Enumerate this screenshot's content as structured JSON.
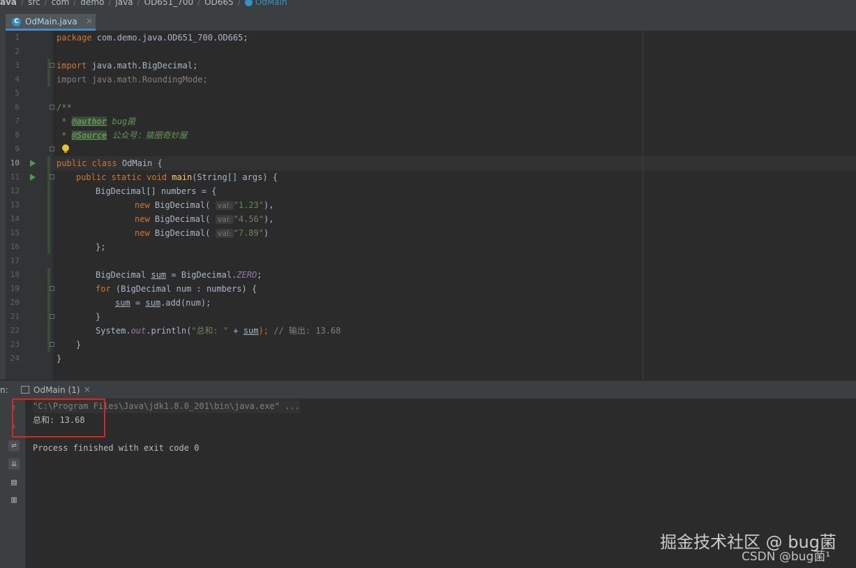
{
  "breadcrumb": [
    "ava",
    "src",
    "com",
    "demo",
    "java",
    "OD651_700",
    "OD665",
    "OdMain"
  ],
  "tab": {
    "icon": "class-icon",
    "label": "OdMain.java",
    "close": "×"
  },
  "gutter": {
    "lines": [
      "1",
      "2",
      "3",
      "4",
      "5",
      "6",
      "7",
      "8",
      "9",
      "10",
      "11",
      "12",
      "13",
      "14",
      "15",
      "16",
      "17",
      "18",
      "19",
      "20",
      "21",
      "22",
      "23",
      "24"
    ]
  },
  "code": {
    "l1": {
      "kw": "package",
      "rest": " com.demo.java.OD651_700.OD665;"
    },
    "l3": {
      "kw": "import",
      "rest": " java.math.BigDecimal;"
    },
    "l4": {
      "kw": "import",
      "rest": " java.math.RoundingMode;"
    },
    "l6": "/**",
    "l7": {
      "pre": " * ",
      "tag": "@author",
      "text": " bug菌"
    },
    "l8": {
      "pre": " * ",
      "tag": "@Source",
      "text": " 公众号：猿圈奇妙屋"
    },
    "l9": " */",
    "l10": {
      "kw": "public class",
      "rest": " OdMain {"
    },
    "l11": {
      "kw": "public static void",
      "fn": "main",
      "rest": "(String[] args) {"
    },
    "l12": "BigDecimal[] numbers = {",
    "l13": {
      "kw": "new",
      "cls": " BigDecimal(",
      "hint": "val:",
      "str": "\"1.23\"",
      "end": "),"
    },
    "l14": {
      "kw": "new",
      "cls": " BigDecimal(",
      "hint": "val:",
      "str": "\"4.56\"",
      "end": "),"
    },
    "l15": {
      "kw": "new",
      "cls": " BigDecimal(",
      "hint": "val:",
      "str": "\"7.89\"",
      "end": ")"
    },
    "l16": "};",
    "l18": {
      "type": "BigDecimal ",
      "var": "sum",
      "mid": " = BigDecimal.",
      "stat": "ZERO",
      "end": ";"
    },
    "l19": {
      "kw": "for",
      "rest": " (BigDecimal num : numbers) {"
    },
    "l20": {
      "var": "sum",
      "mid": " = ",
      "var2": "sum",
      "rest": ".add(num);"
    },
    "l21": "}",
    "l22": {
      "pre": "System.",
      "stat": "out",
      "mid": ".println(",
      "str": "\"总和: \"",
      "plus": " + ",
      "var": "sum",
      "end": ");",
      "comment": " // 输出: 13.68"
    },
    "l23": "}",
    "l24": "}"
  },
  "run_panel": {
    "prefix": "n:",
    "tab_label": "OdMain (1)",
    "tab_close": "×",
    "icons": [
      "up-arrow-icon",
      "down-arrow-icon",
      "soft-wrap-icon",
      "scroll-to-end-icon",
      "print-icon",
      "trash-icon"
    ],
    "console": {
      "command": "\"C:\\Program Files\\Java\\jdk1.8.0_201\\bin\\java.exe\" ...",
      "output": "总和: 13.68",
      "finished": "Process finished with exit code 0"
    }
  },
  "watermark": {
    "line1": "掘金技术社区 @ bug菌",
    "line2": "CSDN @bug菌¹"
  },
  "colors": {
    "accent": "#4a88c7",
    "keyword": "#cc7832",
    "string": "#6a8759",
    "highlight_box": "#e0261c"
  }
}
